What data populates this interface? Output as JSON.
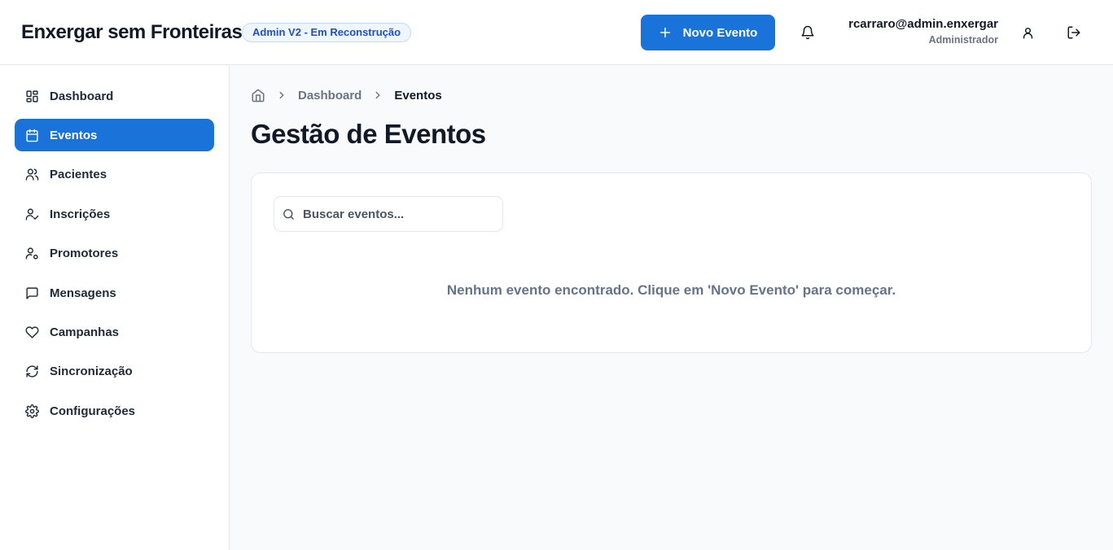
{
  "header": {
    "app_title": "Enxergar sem Fronteiras",
    "version_badge": "Admin V2 - Em Reconstrução",
    "new_event_label": "Novo Evento",
    "user_email": "rcarraro@admin.enxergar",
    "user_role": "Administrador"
  },
  "sidebar": {
    "items": [
      {
        "label": "Dashboard",
        "icon": "dashboard-icon",
        "active": false
      },
      {
        "label": "Eventos",
        "icon": "calendar-icon",
        "active": true
      },
      {
        "label": "Pacientes",
        "icon": "users-icon",
        "active": false
      },
      {
        "label": "Inscrições",
        "icon": "user-check-icon",
        "active": false
      },
      {
        "label": "Promotores",
        "icon": "user-cog-icon",
        "active": false
      },
      {
        "label": "Mensagens",
        "icon": "message-icon",
        "active": false
      },
      {
        "label": "Campanhas",
        "icon": "heart-icon",
        "active": false
      },
      {
        "label": "Sincronização",
        "icon": "refresh-icon",
        "active": false
      },
      {
        "label": "Configurações",
        "icon": "gear-icon",
        "active": false
      }
    ]
  },
  "breadcrumb": {
    "home_icon": "home-icon",
    "items": [
      "Dashboard",
      "Eventos"
    ]
  },
  "main": {
    "page_title": "Gestão de Eventos",
    "search_placeholder": "Buscar eventos...",
    "empty_message": "Nenhum evento encontrado. Clique em 'Novo Evento' para começar."
  },
  "colors": {
    "accent": "#1a73d9",
    "badge_bg": "#eff6ff",
    "badge_text": "#1d4ed8",
    "main_bg": "#f8fafc"
  }
}
